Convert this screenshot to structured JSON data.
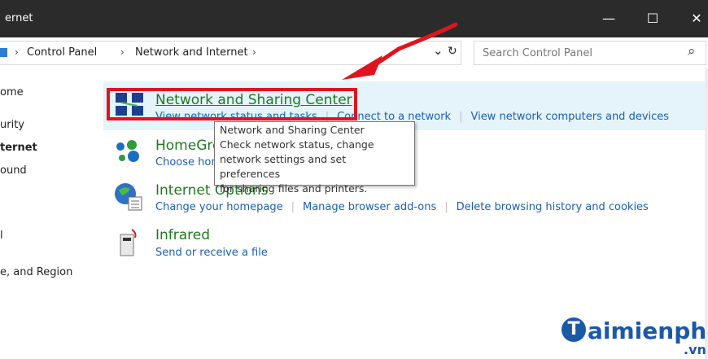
{
  "window": {
    "title": "ernet",
    "minimize_glyph": "—",
    "maximize_glyph": "☐",
    "close_glyph": "✕"
  },
  "address": {
    "breadcrumb": [
      "Control Panel",
      "Network and Internet"
    ],
    "separator": "›",
    "dropdown_glyph": "⌄",
    "refresh_glyph": "↻"
  },
  "search": {
    "placeholder": "Search Control Panel",
    "search_glyph": "⌕"
  },
  "sidebar": {
    "items": [
      "ome",
      "urity",
      "ternet",
      "ound",
      "l",
      "e, and Region"
    ]
  },
  "categories": [
    {
      "name": "Network and Sharing Center",
      "icon": "network-sharing-icon",
      "links": [
        "View network status and tasks",
        "Connect to a network",
        "View network computers and devices"
      ]
    },
    {
      "name": "HomeGroup",
      "icon": "homegroup-icon",
      "links": [
        "Choose homegroup and sharing options"
      ]
    },
    {
      "name": "Internet Options",
      "icon": "internet-options-icon",
      "links": [
        "Change your homepage",
        "Manage browser add-ons",
        "Delete browsing history and cookies"
      ]
    },
    {
      "name": "Infrared",
      "icon": "infrared-icon",
      "links": [
        "Send or receive a file"
      ]
    }
  ],
  "tooltip": {
    "lines": [
      "Network and Sharing Center",
      "Check network status, change",
      "network settings and set preferences",
      "for sharing files and printers."
    ]
  },
  "watermark": {
    "text": "aimienphi",
    "suffix": ".vn",
    "initial": "T"
  },
  "colors": {
    "titlebar": "#2b2b2b",
    "link": "#1a5fb4",
    "category": "#1e7a1e",
    "highlight_border": "#e0141e",
    "arrow": "#e0141e"
  }
}
